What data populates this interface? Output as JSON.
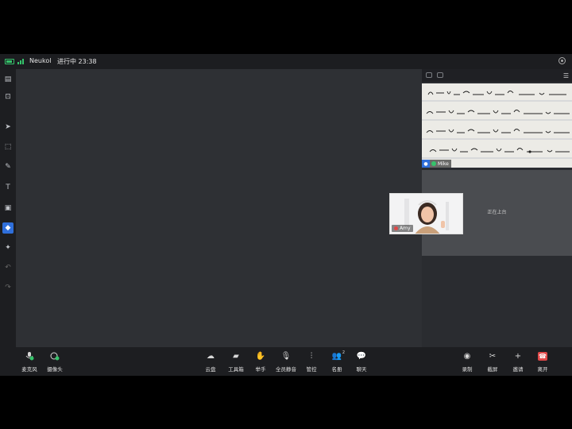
{
  "topbar": {
    "app_name": "Neukol",
    "status": "进行中 23:38",
    "battery_color": "#35c46b",
    "settings_icon": "gear-icon"
  },
  "left_tools": [
    {
      "name": "whiteboard-icon",
      "glyph": "▤"
    },
    {
      "name": "screen-share-icon",
      "glyph": "⊡"
    },
    {
      "name": "select-pointer-icon",
      "glyph": "➤"
    },
    {
      "name": "area-select-icon",
      "glyph": "⬚"
    },
    {
      "name": "pen-icon",
      "glyph": "✎"
    },
    {
      "name": "text-icon",
      "glyph": "T"
    },
    {
      "name": "image-icon",
      "glyph": "▣"
    },
    {
      "name": "eraser-icon",
      "glyph": "◆",
      "active": true
    },
    {
      "name": "laser-pointer-icon",
      "glyph": "✦"
    },
    {
      "name": "undo-icon",
      "glyph": "↶",
      "dim": true
    },
    {
      "name": "redo-icon",
      "glyph": "↷",
      "dim": true
    }
  ],
  "participants": {
    "mike": {
      "name": "Mike"
    },
    "amy": {
      "name": "Amy"
    },
    "empty_slot_text": "正在上台"
  },
  "bottom_left": [
    {
      "name": "microphone-button",
      "icon": "microphone-icon",
      "label": "麦克风"
    },
    {
      "name": "camera-button",
      "icon": "camera-icon",
      "label": "摄像头"
    }
  ],
  "bottom_center": [
    {
      "name": "cloud-drive-button",
      "icon": "cloud-icon",
      "label": "云盘",
      "glyph": "☁"
    },
    {
      "name": "toolbox-button",
      "icon": "toolbox-icon",
      "label": "工具箱",
      "glyph": "▰"
    },
    {
      "name": "raise-hand-button",
      "icon": "hand-icon",
      "label": "举手",
      "glyph": "✋"
    },
    {
      "name": "mute-all-button",
      "icon": "mute-all-icon",
      "label": "全员静音",
      "glyph": "🎙"
    },
    {
      "name": "manage-button",
      "icon": "sliders-icon",
      "label": "管控",
      "glyph": "⫶"
    },
    {
      "name": "roster-button",
      "icon": "people-icon",
      "label": "名册",
      "glyph": "👥",
      "badge": "2"
    },
    {
      "name": "chat-button",
      "icon": "chat-bubble-icon",
      "label": "聊天",
      "glyph": "💬"
    }
  ],
  "bottom_right": [
    {
      "name": "record-button",
      "icon": "record-icon",
      "label": "录制",
      "glyph": "◉"
    },
    {
      "name": "screenshot-button",
      "icon": "scissors-icon",
      "label": "截屏",
      "glyph": "✂"
    },
    {
      "name": "invite-button",
      "icon": "plus-icon",
      "label": "邀请",
      "glyph": "+"
    },
    {
      "name": "leave-button",
      "icon": "hang-up-icon",
      "label": "离开",
      "glyph": "☎",
      "color": "#e04848"
    }
  ]
}
